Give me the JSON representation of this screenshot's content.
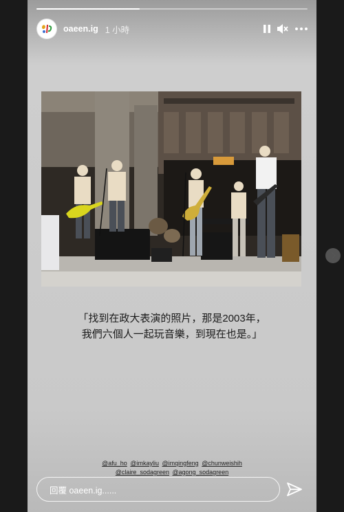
{
  "progress": 0.38,
  "header": {
    "username": "oaeen.ig",
    "time": "1 小時"
  },
  "icons": {
    "pause": "pause-icon",
    "mute": "mute-icon",
    "more": "more-icon",
    "send": "send-icon",
    "next": "chevron-right-icon"
  },
  "caption": {
    "line1": "「找到在政大表演的照片，那是2003年，",
    "line2": "我們六個人一起玩音樂，到現在也是。」"
  },
  "mentions": [
    "@afu_ho",
    "@imkayliu",
    "@imqingfeng",
    "@chunweishih",
    "@claire_sodagreen",
    "@agong_sodagreen"
  ],
  "reply": {
    "placeholder": "回覆 oaeen.ig......"
  }
}
